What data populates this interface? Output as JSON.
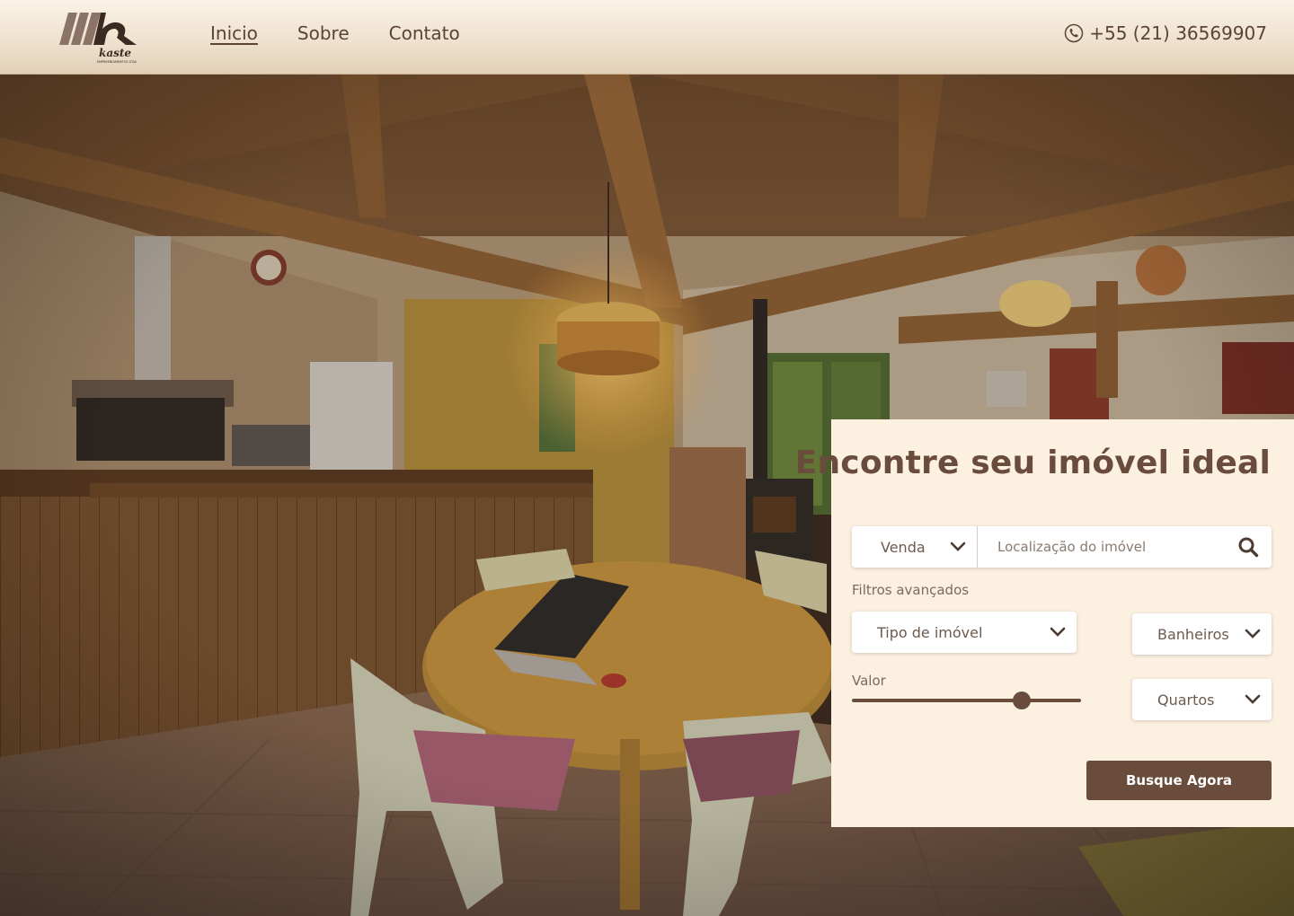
{
  "header": {
    "logo_text": "kaste",
    "logo_subtext": "EMPREENDIMENTOS LTDA",
    "nav": [
      {
        "label": "Inicio",
        "active": true
      },
      {
        "label": "Sobre",
        "active": false
      },
      {
        "label": "Contato",
        "active": false
      }
    ],
    "phone": "+55 (21) 36569907",
    "phone_icon": "phone-icon"
  },
  "search": {
    "title": "Encontre seu imóvel ideal",
    "deal_type": "Venda",
    "location_placeholder": "Localização do imóvel",
    "advanced_label": "Filtros avançados",
    "property_type": "Tipo de imóvel",
    "bathrooms": "Banheiros",
    "rooms": "Quartos",
    "price_label": "Valor",
    "price_level": 0.74,
    "submit_label": "Busque Agora"
  },
  "colors": {
    "accent": "#6a4c3c",
    "panel_bg": "#fcf0e1",
    "header_bg": "#efe2cf"
  }
}
